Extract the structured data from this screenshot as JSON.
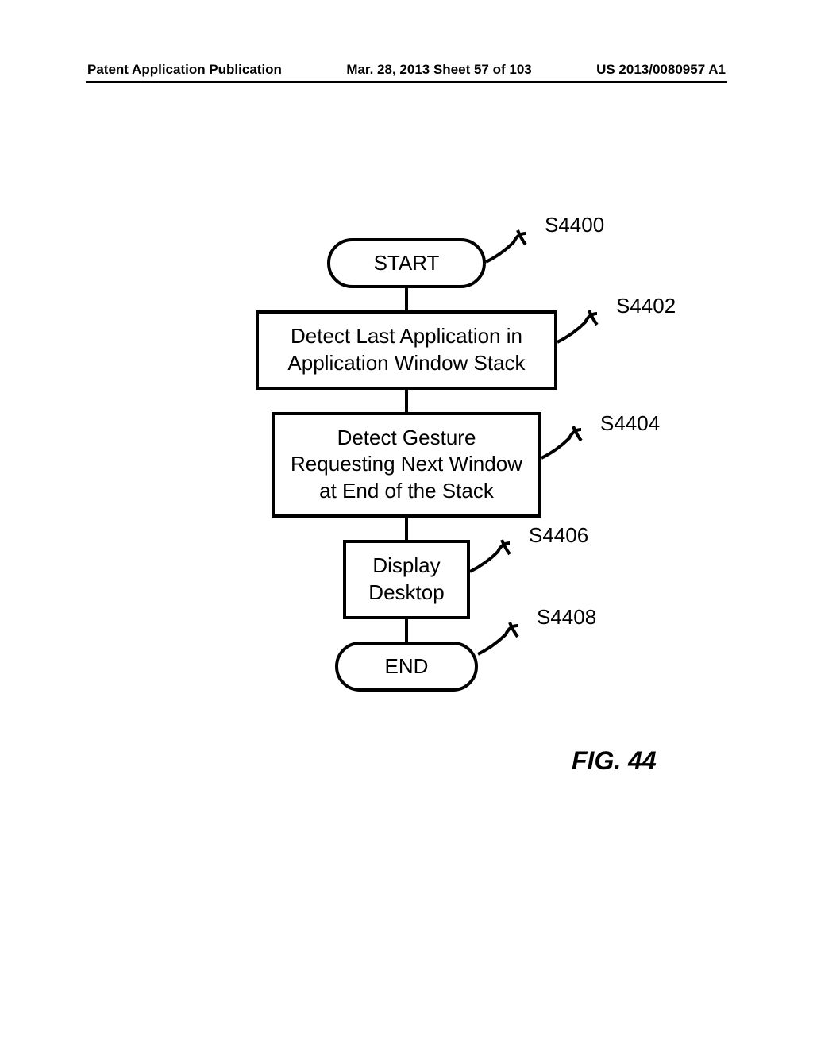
{
  "header": {
    "left": "Patent Application Publication",
    "center": "Mar. 28, 2013 Sheet 57 of 103",
    "right": "US 2013/0080957 A1"
  },
  "flowchart": {
    "start": {
      "label": "START",
      "ref": "S4400"
    },
    "step1": {
      "label": "Detect Last Application in Application Window Stack",
      "ref": "S4402"
    },
    "step2": {
      "label": "Detect Gesture Requesting Next Window at End of the Stack",
      "ref": "S4404"
    },
    "step3": {
      "label": "Display Desktop",
      "ref": "S4406"
    },
    "end": {
      "label": "END",
      "ref": "S4408"
    }
  },
  "figure": "FIG. 44"
}
